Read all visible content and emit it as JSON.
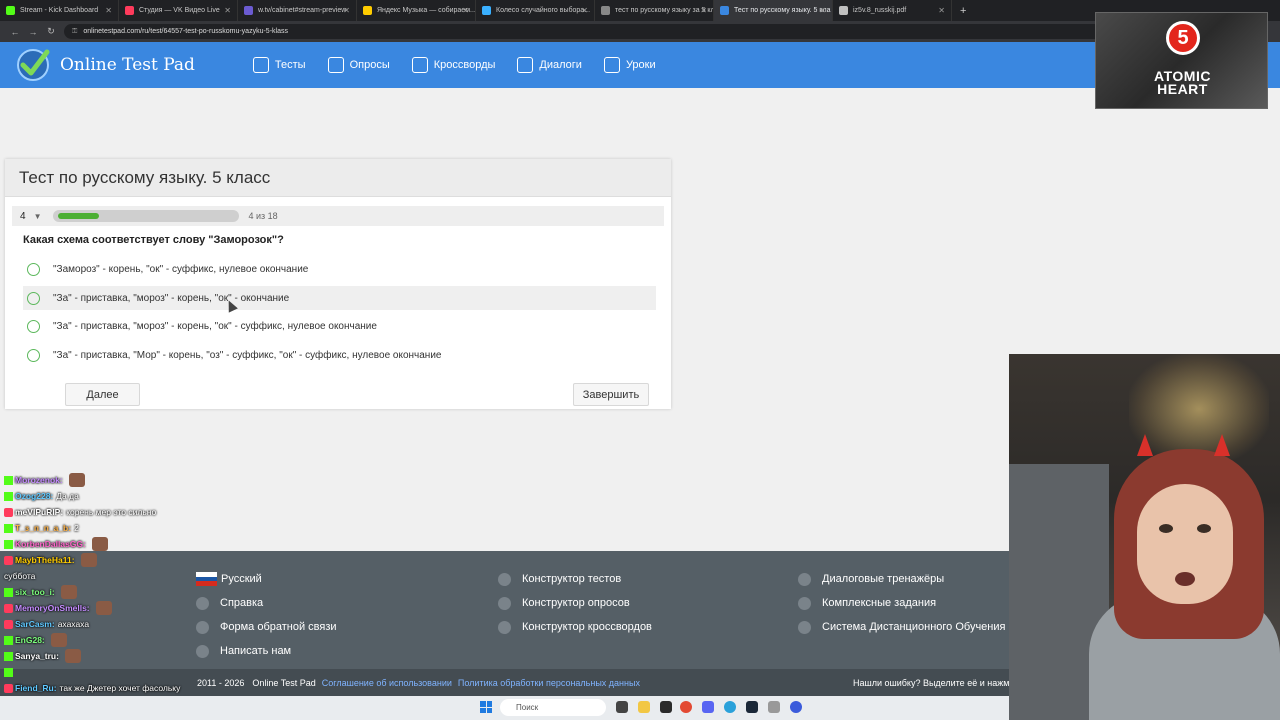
{
  "browser": {
    "tabs": [
      {
        "title": "Stream - Kick Dashboard",
        "color": "#53fc18"
      },
      {
        "title": "Студия — VK Видео Live",
        "color": "#ff3b5c"
      },
      {
        "title": "w.tv/cabinet#stream-preview",
        "color": "#6b5bd2"
      },
      {
        "title": "Яндекс Музыка — собираем...",
        "color": "#ffcc00"
      },
      {
        "title": "Колесо случайного выбора...",
        "color": "#3ab0ff"
      },
      {
        "title": "тест по русскому языку за 5 кл",
        "color": "#888888"
      },
      {
        "title": "Тест по русскому языку. 5 кла",
        "color": "#3a87e0"
      },
      {
        "title": "iz5v.8_russkij.pdf",
        "color": "#c0c0c0"
      }
    ],
    "active_tab": 6,
    "url": "onlinetestpad.com/ru/test/64557-test-po-russkomu-yazyku-5-klass"
  },
  "site": {
    "name": "Online Test Pad",
    "nav": [
      {
        "label": "Тесты",
        "icon": "test-icon"
      },
      {
        "label": "Опросы",
        "icon": "poll-icon"
      },
      {
        "label": "Кроссворды",
        "icon": "crossword-icon"
      },
      {
        "label": "Диалоги",
        "icon": "dialog-icon"
      },
      {
        "label": "Уроки",
        "icon": "lesson-icon"
      }
    ],
    "accent": "#3a87e0"
  },
  "test": {
    "title": "Тест по русскому языку. 5 класс",
    "current_question": "4",
    "progress_text": "4 из 18",
    "progress_fraction": 0.22,
    "question": "Какая схема соответствует слову \"Заморозок\"?",
    "answers": [
      "\"Замороз\" - корень, \"ок\" - суффикс, нулевое окончание",
      "\"За\" - приставка, \"мороз\" - корень, \"ок\" - окончание",
      "\"За\" - приставка, \"мороз\" - корень, \"ок\" - суффикс, нулевое окончание",
      "\"За\" - приставка, \"Мор\" - корень, \"оз\" - суффикс, \"ок\" - суффикс, нулевое окончание"
    ],
    "hovered_answer": 1,
    "next_label": "Далее",
    "finish_label": "Завершить"
  },
  "footer": {
    "col1": [
      "Русский",
      "Справка",
      "Форма обратной связи",
      "Написать нам"
    ],
    "col2": [
      "Конструктор тестов",
      "Конструктор опросов",
      "Конструктор кроссвордов"
    ],
    "col3": [
      "Диалоговые тренажёры",
      "Комплексные задания",
      "Система Дистанционного Обучения"
    ],
    "copyright": "2011 - 2026",
    "brand": "Online Test Pad",
    "terms": "Соглашение об использовании",
    "privacy": "Политика обработки персональных данных",
    "error_hint": "Нашли ошибку? Выделите её и нажм"
  },
  "taskbar": {
    "search_placeholder": "Поиск"
  },
  "chat": [
    {
      "platform": "k",
      "nick": "Morozenok:",
      "text": "",
      "nick_color": "#c58bff"
    },
    {
      "platform": "k",
      "nick": "Ozog228:",
      "text": "Да да",
      "nick_color": "#5ec8ff"
    },
    {
      "platform": "v",
      "nick": "meVIPuRIP:",
      "text": "корень мер это сильно",
      "nick_color": "#ffffff"
    },
    {
      "platform": "k",
      "nick": "T_з_п_п_а_b:",
      "text": "2",
      "nick_color": "#ffb347"
    },
    {
      "platform": "k",
      "nick": "KorbenDallasGG:",
      "text": "",
      "nick_color": "#ff66cc"
    },
    {
      "platform": "v",
      "nick": "MaybTheHa11:",
      "text": "",
      "nick_color": "#ffcc00"
    },
    {
      "platform": "",
      "nick": "",
      "text": "суббота",
      "nick_color": "#ffffff"
    },
    {
      "platform": "k",
      "nick": "six_too_i:",
      "text": "",
      "nick_color": "#7cff7c"
    },
    {
      "platform": "v",
      "nick": "MemoryOnSmells:",
      "text": "",
      "nick_color": "#c58bff"
    },
    {
      "platform": "v",
      "nick": "SarCasm:",
      "text": "ахахаха",
      "nick_color": "#5ec8ff"
    },
    {
      "platform": "k",
      "nick": "EnG28:",
      "text": "",
      "nick_color": "#7cff7c"
    },
    {
      "platform": "k",
      "nick": "Sanya_tru:",
      "text": "",
      "nick_color": "#ffffff"
    },
    {
      "platform": "k",
      "nick": "",
      "text": "",
      "nick_color": "#ff3b5c"
    },
    {
      "platform": "v",
      "nick": "Fiend_Ru:",
      "text": "так же Джетер хочет фасольку",
      "nick_color": "#5ec8ff"
    }
  ],
  "overlay": {
    "game_badge": "5",
    "game_title_line1": "ATOMIC",
    "game_title_line2": "HEART"
  }
}
